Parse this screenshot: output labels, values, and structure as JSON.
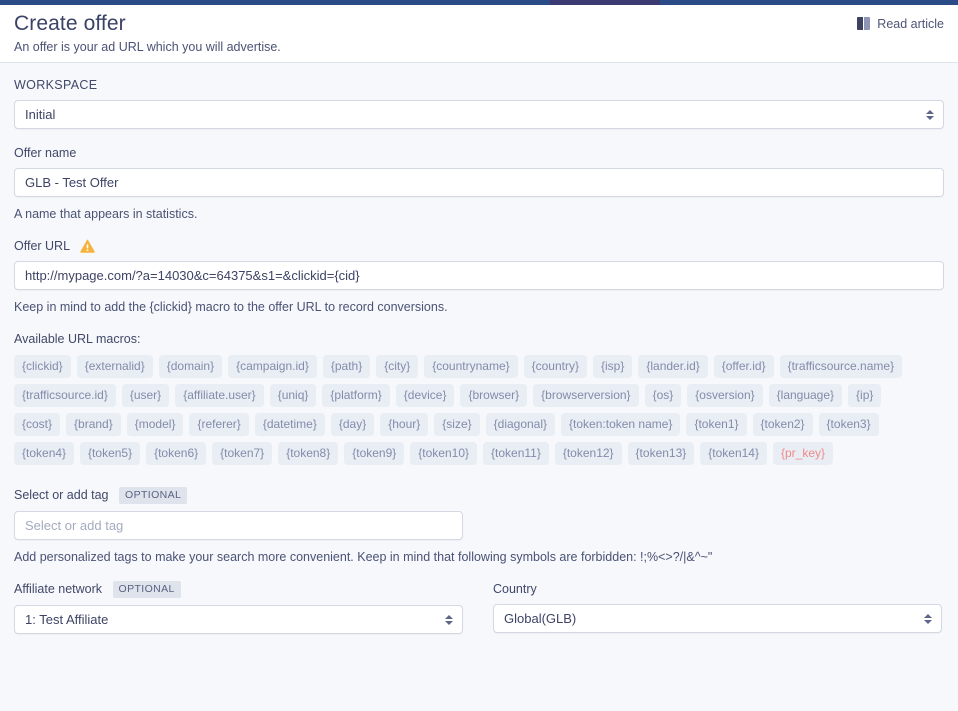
{
  "header": {
    "title": "Create offer",
    "subtitle": "An offer is your ad URL which you will advertise.",
    "read_article_label": "Read article",
    "read_article_icon": "book-icon"
  },
  "colors": {
    "top_strip": "#2b4b86",
    "top_strip_accent": "#3b3a72",
    "page_background": "#f6f8fb",
    "header_background": "#ffffff",
    "text": "#3d4465",
    "chip_background": "#e9edf4",
    "chip_text": "#848cab",
    "chip_danger_text": "#ef8a8a",
    "badge_background": "#dfe3ec",
    "warning": "#f5b33c",
    "input_border": "#d3d8e3"
  },
  "workspace": {
    "label": "WORKSPACE",
    "value": "Initial",
    "options": [
      "Initial"
    ]
  },
  "offer_name": {
    "label": "Offer name",
    "value": "GLB - Test Offer",
    "helper": "A name that appears in statistics."
  },
  "offer_url": {
    "label": "Offer URL",
    "warning_icon": "warning-triangle-icon",
    "value": "http://mypage.com/?a=14030&c=64375&s1=&clickid={cid}",
    "helper": "Keep in mind to add the {clickid} macro to the offer URL to record conversions."
  },
  "macros": {
    "title": "Available URL macros:",
    "rows": [
      [
        "{clickid}",
        "{externalid}",
        "{domain}",
        "{campaign.id}",
        "{path}",
        "{city}",
        "{countryname}",
        "{country}",
        "{isp}",
        "{lander.id}",
        "{offer.id}",
        "{trafficsource.name}"
      ],
      [
        "{trafficsource.id}",
        "{user}",
        "{affiliate.user}",
        "{uniq}",
        "{platform}",
        "{device}",
        "{browser}",
        "{browserversion}",
        "{os}",
        "{osversion}",
        "{language}",
        "{ip}"
      ],
      [
        "{cost}",
        "{brand}",
        "{model}",
        "{referer}",
        "{datetime}",
        "{day}",
        "{hour}",
        "{size}",
        "{diagonal}",
        "{token:token name}",
        "{token1}",
        "{token2}",
        "{token3}"
      ],
      [
        "{token4}",
        "{token5}",
        "{token6}",
        "{token7}",
        "{token8}",
        "{token9}",
        "{token10}",
        "{token11}",
        "{token12}",
        "{token13}",
        "{token14}",
        "{pr_key}"
      ]
    ],
    "danger_macros": [
      "{pr_key}"
    ]
  },
  "tag": {
    "label": "Select or add tag",
    "optional_badge": "OPTIONAL",
    "placeholder": "Select or add tag",
    "value": "",
    "helper": "Add personalized tags to make your search more convenient. Keep in mind that following symbols are forbidden: !;%<>?/|&^~\""
  },
  "affiliate_network": {
    "label": "Affiliate network",
    "optional_badge": "OPTIONAL",
    "value": "1: Test Affiliate",
    "options": [
      "1: Test Affiliate"
    ]
  },
  "country": {
    "label": "Country",
    "value": "Global(GLB)",
    "options": [
      "Global(GLB)"
    ]
  }
}
